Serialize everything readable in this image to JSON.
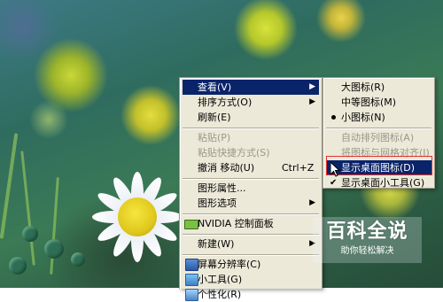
{
  "context_menu": {
    "items": [
      {
        "label": "查看(V)",
        "submenu": true
      },
      {
        "label": "排序方式(O)",
        "submenu": true
      },
      {
        "label": "刷新(E)"
      },
      {
        "label": "粘贴(P)",
        "disabled": true
      },
      {
        "label": "粘贴快捷方式(S)",
        "disabled": true
      },
      {
        "label": "撤消 移动(U)",
        "shortcut": "Ctrl+Z"
      },
      {
        "label": "图形属性..."
      },
      {
        "label": "图形选项",
        "submenu": true
      },
      {
        "label": "NVIDIA 控制面板",
        "icon": "nvidia-icon"
      },
      {
        "label": "新建(W)",
        "submenu": true
      },
      {
        "label": "屏幕分辨率(C)",
        "icon": "screen-resolution-icon"
      },
      {
        "label": "小工具(G)",
        "icon": "gadgets-icon"
      },
      {
        "label": "个性化(R)",
        "icon": "personalize-icon"
      }
    ]
  },
  "view_submenu": {
    "items": [
      {
        "label": "大图标(R)"
      },
      {
        "label": "中等图标(M)"
      },
      {
        "label": "小图标(N)",
        "selected": true
      },
      {
        "label": "自动排列图标(A)",
        "disabled": true
      },
      {
        "label": "将图标与网格对齐(I)",
        "disabled": true
      },
      {
        "label": "显示桌面图标(D)",
        "highlighted": true
      },
      {
        "label": "显示桌面小工具(G)",
        "checked": true
      }
    ]
  },
  "watermark": {
    "title": "百科全说",
    "subtitle": "助你轻松解决"
  },
  "colors": {
    "menu_background": "#ece9d8",
    "highlight": "#0a246a",
    "callout_border": "#e2322c"
  }
}
